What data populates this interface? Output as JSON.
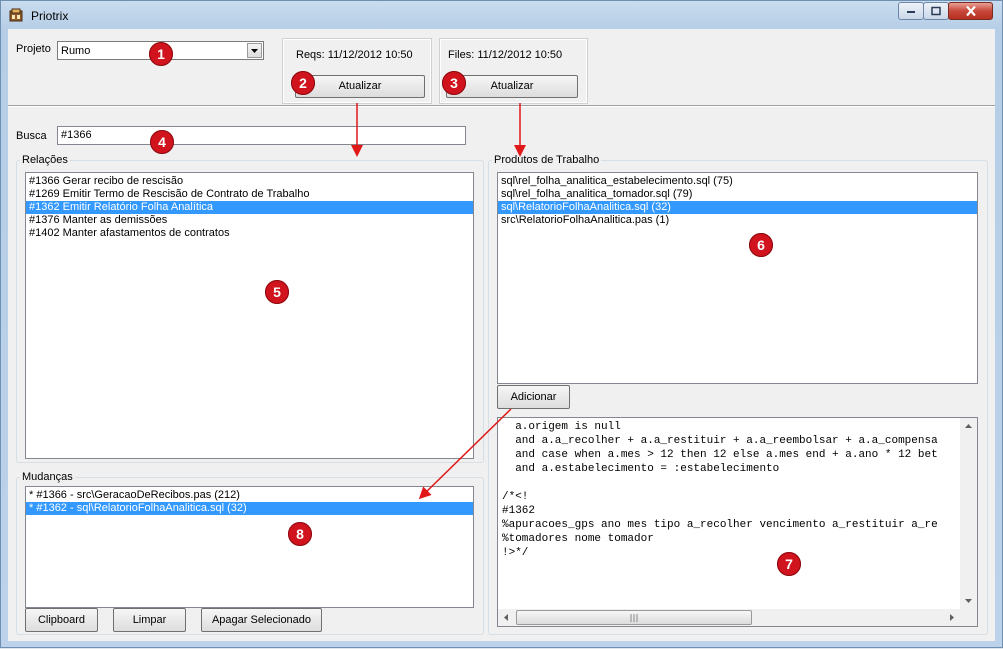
{
  "window": {
    "title": "Priotrix"
  },
  "projeto": {
    "label": "Projeto",
    "value": "Rumo"
  },
  "reqs": {
    "label": "Reqs: 11/12/2012 10:50",
    "button": "Atualizar"
  },
  "files": {
    "label": "Files: 11/12/2012 10:50",
    "button": "Atualizar"
  },
  "busca": {
    "label": "Busca",
    "value": "#1366"
  },
  "relacoes": {
    "title": "Relações",
    "items": [
      "#1366 Gerar recibo de rescisão",
      "#1269 Emitir Termo de Rescisão de Contrato de Trabalho",
      "#1362 Emitir Relatório Folha Analítica",
      "#1376 Manter as demissões",
      "#1402 Manter afastamentos de contratos"
    ],
    "selected_index": 2
  },
  "produtos": {
    "title": "Produtos de Trabalho",
    "items": [
      "sql\\rel_folha_analitica_estabelecimento.sql (75)",
      "sql\\rel_folha_analitica_tomador.sql (79)",
      "sql\\RelatorioFolhaAnalitica.sql (32)",
      "src\\RelatorioFolhaAnalitica.pas (1)"
    ],
    "selected_index": 2,
    "add_button": "Adicionar"
  },
  "mudancas": {
    "title": "Mudanças",
    "items": [
      "* #1366 - src\\GeracaoDeRecibos.pas (212)",
      "* #1362 - sql\\RelatorioFolhaAnalitica.sql (32)"
    ],
    "selected_index": 1,
    "buttons": {
      "clipboard": "Clipboard",
      "limpar": "Limpar",
      "apagar": "Apagar Selecionado"
    }
  },
  "code": {
    "lines": [
      "  a.origem is null",
      "  and a.a_recolher + a.a_restituir + a.a_reembolsar + a.a_compensa",
      "  and case when a.mes > 12 then 12 else a.mes end + a.ano * 12 bet",
      "  and a.estabelecimento = :estabelecimento",
      "",
      "/*<!",
      "#1362",
      "%apuracoes_gps ano mes tipo a_recolher vencimento a_restituir a_re",
      "%tomadores nome tomador",
      "!>*/"
    ]
  },
  "markers": [
    "1",
    "2",
    "3",
    "4",
    "5",
    "6",
    "7",
    "8"
  ],
  "colors": {
    "selection": "#3399ff",
    "marker": "#d0131c",
    "arrow": "#e01818"
  },
  "icons": {
    "minimize": "minimize-icon",
    "maximize": "maximize-icon",
    "close": "close-icon"
  }
}
